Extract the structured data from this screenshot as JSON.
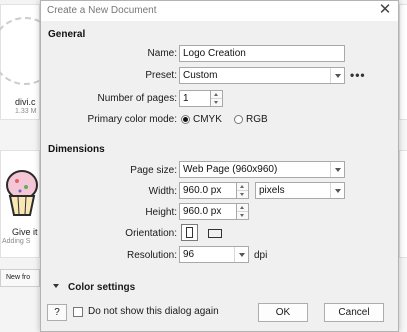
{
  "background": {
    "card1": {
      "title": "divi.c",
      "subtitle": "1.33 M"
    },
    "card2": {
      "title": "Give it",
      "subtitle": "Adding S"
    },
    "new_from_label": "New fro"
  },
  "dialog": {
    "title": "Create a New Document",
    "close_icon": "close-icon",
    "general": {
      "heading": "General",
      "name_label": "Name:",
      "name_value": "Logo Creation",
      "preset_label": "Preset:",
      "preset_value": "Custom",
      "more_options": "•••",
      "pages_label": "Number of pages:",
      "pages_value": "1",
      "color_mode_label": "Primary color mode:",
      "color_modes": [
        {
          "label": "CMYK",
          "checked": true
        },
        {
          "label": "RGB",
          "checked": false
        }
      ]
    },
    "dimensions": {
      "heading": "Dimensions",
      "page_size_label": "Page size:",
      "page_size_value": "Web Page (960x960)",
      "width_label": "Width:",
      "width_value": "960.0 px",
      "units_value": "pixels",
      "height_label": "Height:",
      "height_value": "960.0 px",
      "orientation_label": "Orientation:",
      "orientations": [
        "portrait-icon",
        "landscape-icon"
      ],
      "resolution_label": "Resolution:",
      "resolution_value": "96",
      "resolution_unit": "dpi"
    },
    "color_settings_label": "Color settings",
    "help_label": "?",
    "dont_show_label": "Do not show this dialog again",
    "ok_label": "OK",
    "cancel_label": "Cancel"
  }
}
